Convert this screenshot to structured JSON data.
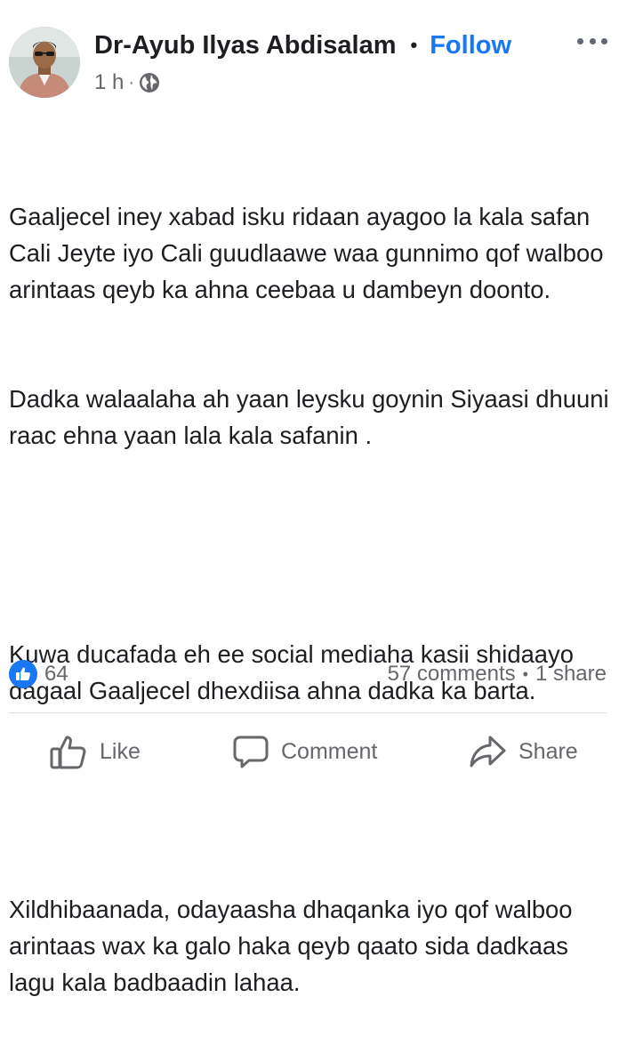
{
  "post": {
    "author": "Dr-Ayub Ilyas Abdisalam",
    "separator": "•",
    "follow_label": "Follow",
    "time": "1 h",
    "meta_sep": "·",
    "audience_icon": "globe-icon",
    "more_icon": "more-horizontal-icon",
    "text": [
      "Gaaljecel iney xabad isku ridaan ayagoo la kala safan Cali Jeyte iyo Cali guudlaawe waa gunnimo qof walboo arintaas qeyb ka ahna ceebaa u dambeyn doonto.",
      "Dadka walaalaha ah yaan leysku goynin Siyaasi dhuuni raac ehna yaan lala kala safanin .",
      "",
      "Kuwa ducafada eh ee social mediaha kasii shidaayo dagaal Gaaljecel dhexdiisa ahna dadka ka barta.",
      "",
      "Xildhibaanada, odayaasha dhaqanka iyo qof walboo arintaas wax ka galo haka qeyb qaato sida dadkaas lagu kala badbaadin lahaa."
    ]
  },
  "stats": {
    "reaction_icon": "like-reaction-icon",
    "reaction_count": "64",
    "comments": "57 comments",
    "sep": "•",
    "shares": "1 share"
  },
  "actions": {
    "like": "Like",
    "comment": "Comment",
    "share": "Share"
  },
  "colors": {
    "accent": "#1877f2",
    "text": "#1c1e21",
    "muted": "#65676b",
    "divider": "#dadde1"
  }
}
